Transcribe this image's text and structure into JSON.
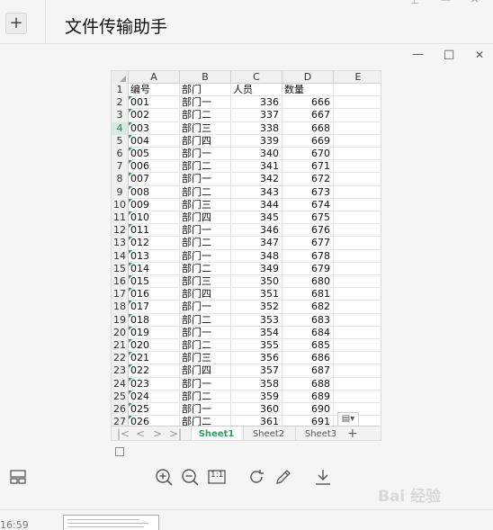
{
  "chat": {
    "plus_label": "+",
    "title": "文件传输助手",
    "pin_label": "⊥",
    "minimize_label": "—",
    "close_label": "✕"
  },
  "viewer": {
    "minimize_label": "—",
    "maximize_label": "□",
    "close_label": "✕"
  },
  "spreadsheet": {
    "columns": [
      "A",
      "B",
      "C",
      "D",
      "E"
    ],
    "row_numbers": [
      "1",
      "2",
      "3",
      "4",
      "5",
      "6",
      "7",
      "8",
      "9",
      "10",
      "11",
      "12",
      "13",
      "14",
      "15",
      "16",
      "17",
      "18",
      "19",
      "20",
      "21",
      "22",
      "23",
      "24",
      "25",
      "26",
      "27"
    ],
    "header": {
      "A": "编号",
      "B": "部门",
      "C": "人员",
      "D": "数量"
    },
    "rows": [
      {
        "A": "001",
        "B": "部门一",
        "C": "336",
        "D": "666"
      },
      {
        "A": "002",
        "B": "部门二",
        "C": "337",
        "D": "667"
      },
      {
        "A": "003",
        "B": "部门三",
        "C": "338",
        "D": "668"
      },
      {
        "A": "004",
        "B": "部门四",
        "C": "339",
        "D": "669"
      },
      {
        "A": "005",
        "B": "部门一",
        "C": "340",
        "D": "670"
      },
      {
        "A": "006",
        "B": "部门二",
        "C": "341",
        "D": "671"
      },
      {
        "A": "007",
        "B": "部门一",
        "C": "342",
        "D": "672"
      },
      {
        "A": "008",
        "B": "部门二",
        "C": "343",
        "D": "673"
      },
      {
        "A": "009",
        "B": "部门三",
        "C": "344",
        "D": "674"
      },
      {
        "A": "010",
        "B": "部门四",
        "C": "345",
        "D": "675"
      },
      {
        "A": "011",
        "B": "部门一",
        "C": "346",
        "D": "676"
      },
      {
        "A": "012",
        "B": "部门二",
        "C": "347",
        "D": "677"
      },
      {
        "A": "013",
        "B": "部门一",
        "C": "348",
        "D": "678"
      },
      {
        "A": "014",
        "B": "部门二",
        "C": "349",
        "D": "679"
      },
      {
        "A": "015",
        "B": "部门三",
        "C": "350",
        "D": "680"
      },
      {
        "A": "016",
        "B": "部门四",
        "C": "351",
        "D": "681"
      },
      {
        "A": "017",
        "B": "部门一",
        "C": "352",
        "D": "682"
      },
      {
        "A": "018",
        "B": "部门二",
        "C": "353",
        "D": "683"
      },
      {
        "A": "019",
        "B": "部门一",
        "C": "354",
        "D": "684"
      },
      {
        "A": "020",
        "B": "部门二",
        "C": "355",
        "D": "685"
      },
      {
        "A": "021",
        "B": "部门三",
        "C": "356",
        "D": "686"
      },
      {
        "A": "022",
        "B": "部门四",
        "C": "357",
        "D": "687"
      },
      {
        "A": "023",
        "B": "部门一",
        "C": "358",
        "D": "688"
      },
      {
        "A": "024",
        "B": "部门二",
        "C": "359",
        "D": "689"
      },
      {
        "A": "025",
        "B": "部门一",
        "C": "360",
        "D": "690"
      },
      {
        "A": "026",
        "B": "部门二",
        "C": "361",
        "D": "691"
      }
    ],
    "selected_row": "4",
    "smart_tag_label": "▤▾",
    "sheets": [
      "Sheet1",
      "Sheet2",
      "Sheet3"
    ],
    "active_sheet": "Sheet1",
    "nav_first": "|<",
    "nav_prev": "<",
    "nav_next": ">",
    "nav_last": ">|",
    "add_sheet_label": "+"
  },
  "toolbar": {
    "actual_size_label": "1:1"
  },
  "bottom": {
    "time": "16:59"
  },
  "watermark": "Bai 经验",
  "colors": {
    "accent_green": "#2e9c5a",
    "icon_gray": "#555555"
  }
}
